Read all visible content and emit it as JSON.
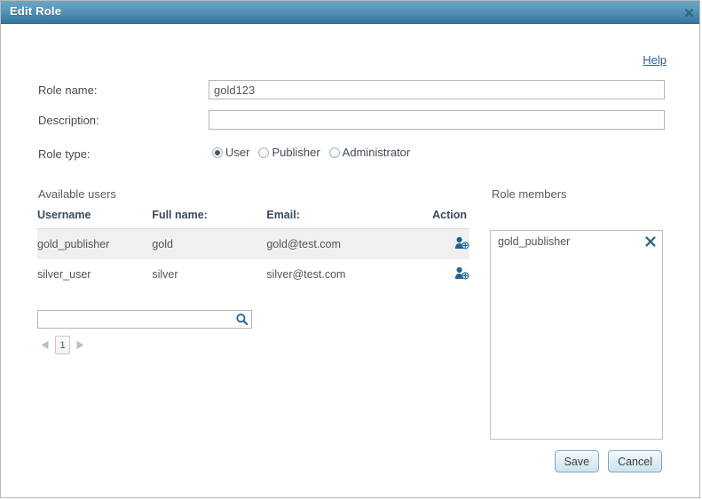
{
  "window": {
    "title": "Edit Role",
    "close_icon": "close-icon"
  },
  "help": {
    "label": "Help"
  },
  "form": {
    "role_name_label": "Role name:",
    "role_name_value": "gold123",
    "role_name_placeholder": "",
    "description_label": "Description:",
    "description_value": "",
    "description_placeholder": "",
    "role_type_label": "Role type:",
    "role_type_options": [
      {
        "label": "User",
        "checked": true
      },
      {
        "label": "Publisher",
        "checked": false
      },
      {
        "label": "Administrator",
        "checked": false
      }
    ]
  },
  "available_users": {
    "title": "Available users",
    "columns": [
      "Username",
      "Full name:",
      "Email:",
      "Action"
    ],
    "rows": [
      {
        "username": "gold_publisher",
        "fullname": "gold",
        "email": "gold@test.com",
        "action_icon": "add-user-icon"
      },
      {
        "username": "silver_user",
        "fullname": "silver",
        "email": "silver@test.com",
        "action_icon": "add-user-icon"
      }
    ],
    "search_value": "",
    "search_placeholder": "",
    "search_icon": "search-icon",
    "pagination": {
      "prev_icon": "triangle-left-icon",
      "next_icon": "triangle-right-icon",
      "current_page": "1"
    }
  },
  "role_members": {
    "title": "Role members",
    "items": [
      {
        "name": "gold_publisher",
        "remove_icon": "close-icon"
      }
    ]
  },
  "footer": {
    "save_label": "Save",
    "cancel_label": "Cancel"
  },
  "colors": {
    "titlebar_top": "#6ca6c4",
    "titlebar_bottom": "#35749a",
    "accent_blue": "#2b5c88",
    "icon_blue": "#1f6390",
    "row_alt": "#f0f0f0",
    "text": "#4f555c",
    "header_text": "#3b4a5a"
  }
}
